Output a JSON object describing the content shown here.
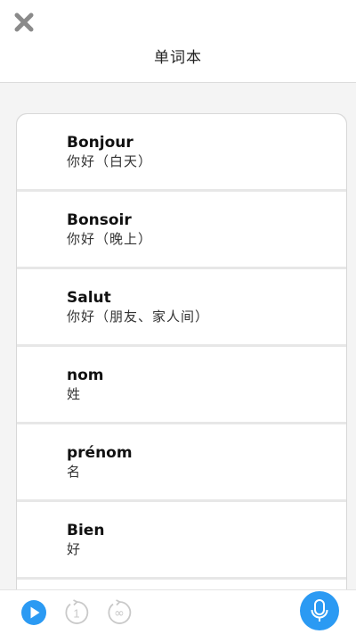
{
  "header": {
    "title": "单词本",
    "close_icon": "close-icon"
  },
  "words": [
    {
      "fr": "Bonjour",
      "zh": "你好（白天）"
    },
    {
      "fr": "Bonsoir",
      "zh": "你好（晚上）"
    },
    {
      "fr": "Salut",
      "zh": "你好（朋友、家人间）"
    },
    {
      "fr": "nom",
      "zh": "姓"
    },
    {
      "fr": "prénom",
      "zh": "名"
    },
    {
      "fr": "Bien",
      "zh": "好"
    },
    {
      "fr": "",
      "zh": ""
    }
  ],
  "footer": {
    "play_icon": "play-icon",
    "repeat_once_icon": "repeat-once-icon",
    "repeat_label": "1",
    "repeat_loop_icon": "repeat-loop-icon",
    "loop_label": "∞",
    "mic_icon": "microphone-icon"
  },
  "colors": {
    "accent": "#2b9af3",
    "disabled_icon": "#c9c9c9",
    "close_icon": "#8a8a8a"
  }
}
